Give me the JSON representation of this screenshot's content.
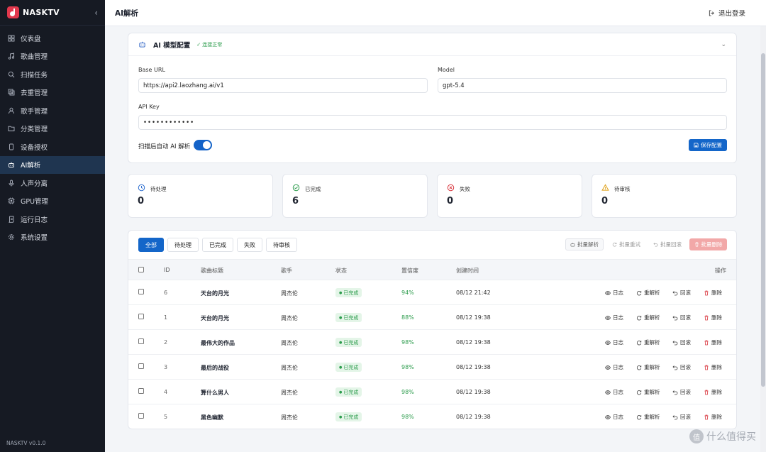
{
  "app": {
    "name": "NASKTV",
    "version": "NASKTV v0.1.0"
  },
  "sidebar": {
    "items": [
      {
        "label": "仪表盘",
        "icon": "dashboard-icon"
      },
      {
        "label": "歌曲管理",
        "icon": "music-note-icon"
      },
      {
        "label": "扫描任务",
        "icon": "search-icon"
      },
      {
        "label": "去重管理",
        "icon": "dedupe-icon"
      },
      {
        "label": "歌手管理",
        "icon": "user-icon"
      },
      {
        "label": "分类管理",
        "icon": "folder-icon"
      },
      {
        "label": "设备授权",
        "icon": "device-icon"
      },
      {
        "label": "AI解析",
        "icon": "bot-icon",
        "active": true
      },
      {
        "label": "人声分离",
        "icon": "mic-icon"
      },
      {
        "label": "GPU管理",
        "icon": "cpu-icon"
      },
      {
        "label": "运行日志",
        "icon": "scroll-icon"
      },
      {
        "label": "系统设置",
        "icon": "gear-icon"
      }
    ]
  },
  "header": {
    "title": "AI解析",
    "logout_label": "退出登录"
  },
  "config": {
    "title": "AI 模型配置",
    "status": "✓ 连接正常",
    "base_url_label": "Base URL",
    "base_url_value": "https://api2.laozhang.ai/v1",
    "model_label": "Model",
    "model_value": "gpt-5.4",
    "api_key_label": "API Key",
    "api_key_value": "••••••••••••",
    "auto_parse_label": "扫描后自动 AI 解析",
    "save_label": "保存配置"
  },
  "stats": [
    {
      "label": "待处理",
      "value": "0",
      "icon": "clock-icon",
      "color": "#2f6fd0"
    },
    {
      "label": "已完成",
      "value": "6",
      "icon": "check-circle-icon",
      "color": "#2e9d4e"
    },
    {
      "label": "失败",
      "value": "0",
      "icon": "x-circle-icon",
      "color": "#d9363e"
    },
    {
      "label": "待审核",
      "value": "0",
      "icon": "warning-icon",
      "color": "#e0a21a"
    }
  ],
  "filters": [
    "全部",
    "待处理",
    "已完成",
    "失败",
    "待审核"
  ],
  "bulk": {
    "parse": "批量解析",
    "retry": "批量重试",
    "rollback": "批量回滚",
    "delete": "批量删除"
  },
  "table": {
    "columns": {
      "id": "ID",
      "title": "歌曲标题",
      "artist": "歌手",
      "status": "状态",
      "confidence": "置信度",
      "created": "创建时间",
      "actions": "操作"
    },
    "actions": {
      "log": "日志",
      "reparse": "重解析",
      "rollback": "回滚",
      "delete": "删除"
    },
    "rows": [
      {
        "id": "6",
        "title": "天台的月光",
        "artist": "周杰伦",
        "status": "已完成",
        "confidence": "94%",
        "created": "08/12 21:42"
      },
      {
        "id": "1",
        "title": "天台的月光",
        "artist": "周杰伦",
        "status": "已完成",
        "confidence": "88%",
        "created": "08/12 19:38"
      },
      {
        "id": "2",
        "title": "最伟大的作品",
        "artist": "周杰伦",
        "status": "已完成",
        "confidence": "98%",
        "created": "08/12 19:38"
      },
      {
        "id": "3",
        "title": "最后的战役",
        "artist": "周杰伦",
        "status": "已完成",
        "confidence": "98%",
        "created": "08/12 19:38"
      },
      {
        "id": "4",
        "title": "算什么男人",
        "artist": "周杰伦",
        "status": "已完成",
        "confidence": "98%",
        "created": "08/12 19:38"
      },
      {
        "id": "5",
        "title": "黑色幽默",
        "artist": "周杰伦",
        "status": "已完成",
        "confidence": "98%",
        "created": "08/12 19:38"
      }
    ]
  },
  "watermark": {
    "mark": "值",
    "text": "什么值得买"
  }
}
